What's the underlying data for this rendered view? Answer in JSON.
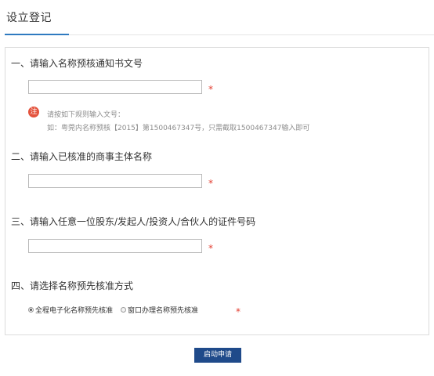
{
  "header": {
    "title": "设立登记"
  },
  "form": {
    "section1": {
      "title": "一、请输入名称预核通知书文号",
      "input_value": "",
      "required_mark": "*",
      "note_badge": "注",
      "note_line1": "请按如下规则输入文号：",
      "note_line2": "如：粤莞内名称预核【2015】第1500467347号，只需截取1500467347输入即可"
    },
    "section2": {
      "title": "二、请输入已核准的商事主体名称",
      "input_value": "",
      "required_mark": "*"
    },
    "section3": {
      "title": "三、请输入任意一位股东/发起人/投资人/合伙人的证件号码",
      "input_value": "",
      "required_mark": "*"
    },
    "section4": {
      "title": "四、请选择名称预先核准方式",
      "options": [
        {
          "label": "全程电子化名称预先核准",
          "selected": true
        },
        {
          "label": "窗口办理名称预先核准",
          "selected": false
        }
      ],
      "required_mark": "*"
    }
  },
  "actions": {
    "submit_label": "启动申请"
  },
  "colors": {
    "accent": "#2f7ac0",
    "button": "#1f4a8a",
    "required": "#e23b2e",
    "note_badge": "#e4533d"
  }
}
